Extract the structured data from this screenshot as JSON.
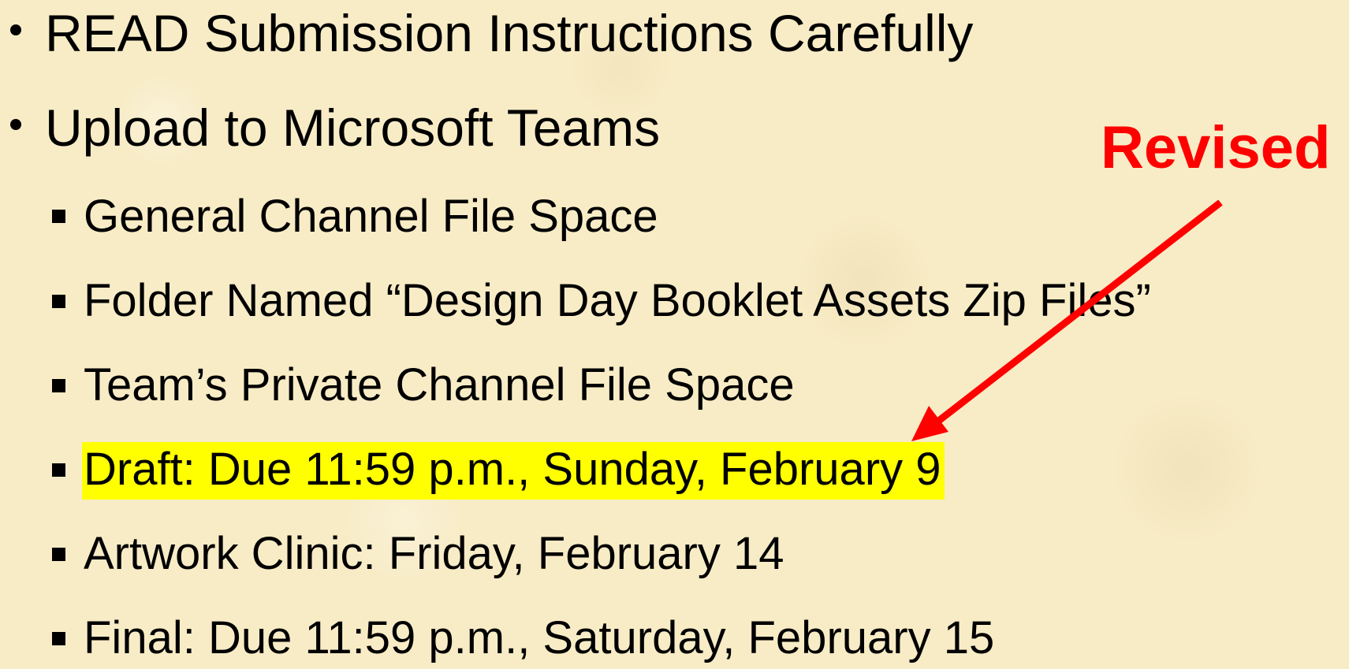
{
  "bullets": [
    {
      "text": "READ Submission Instructions Carefully"
    },
    {
      "text": "Upload to Microsoft Teams"
    }
  ],
  "sub_bullets": [
    {
      "text": "General Channel File Space"
    },
    {
      "text": "Folder Named “Design Day Booklet Assets Zip Files”"
    },
    {
      "text": "Team’s Private Channel File Space"
    },
    {
      "text": "Draft: Due 11:59 p.m., Sunday, February 9"
    },
    {
      "text": "Artwork Clinic: Friday, February 14"
    },
    {
      "text": "Final: Due 11:59 p.m., Saturday, February 15"
    }
  ],
  "annotation": {
    "label": "Revised",
    "color": "#ff0000"
  },
  "colors": {
    "background": "#f8ecc6",
    "highlight": "#ffff00",
    "text": "#000000"
  }
}
